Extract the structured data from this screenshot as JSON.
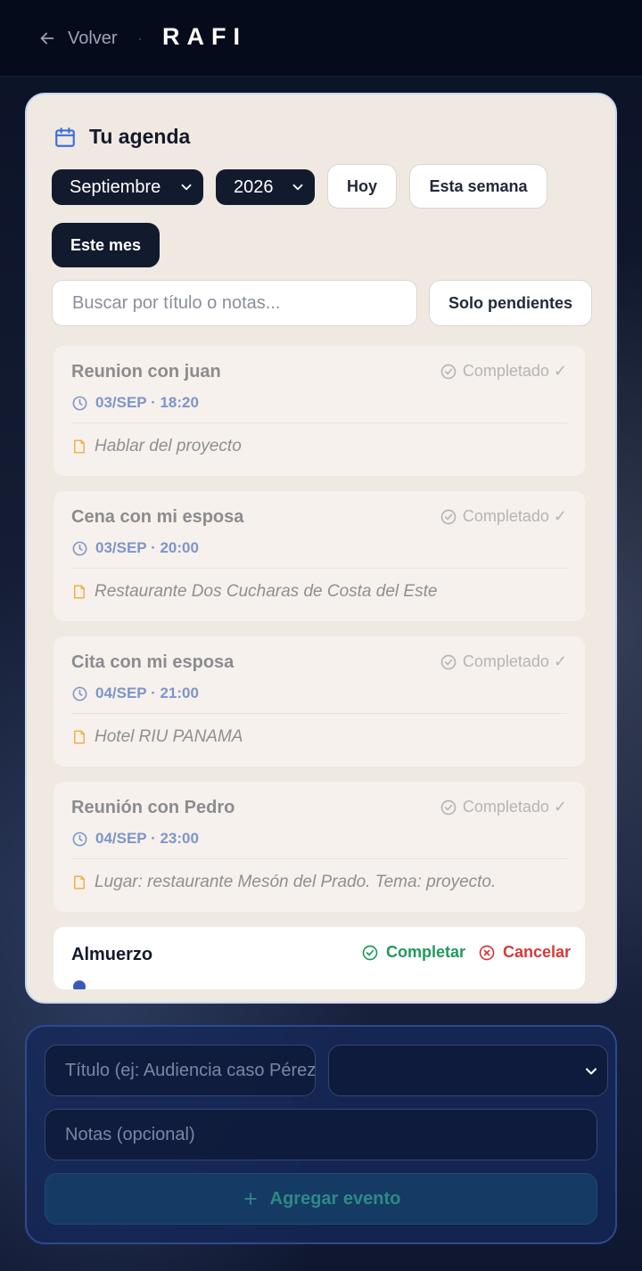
{
  "header": {
    "back_label": "Volver",
    "separator": "·",
    "brand": "RAFI"
  },
  "agenda": {
    "title": "Tu agenda",
    "month_select": "Septiembre",
    "year_select": "2026",
    "filters": {
      "today": "Hoy",
      "week": "Esta semana",
      "month": "Este mes",
      "active_filter": "Este mes"
    },
    "search_placeholder": "Buscar por título o notas...",
    "pending_toggle": "Solo pendientes",
    "events": [
      {
        "title": "Reunion con juan",
        "datetime": "03/SEP · 18:20",
        "note": "Hablar del proyecto",
        "status": "Completado ✓"
      },
      {
        "title": "Cena con mi esposa",
        "datetime": "03/SEP · 20:00",
        "note": "Restaurante Dos Cucharas de Costa del Este",
        "status": "Completado ✓"
      },
      {
        "title": "Cita con mi esposa",
        "datetime": "04/SEP · 21:00",
        "note": "Hotel RIU PANAMA",
        "status": "Completado ✓"
      },
      {
        "title": "Reunión con Pedro",
        "datetime": "04/SEP · 23:00",
        "note": "Lugar: restaurante Mesón del Prado. Tema: proyecto.",
        "status": "Completado ✓"
      }
    ],
    "active_event": {
      "title": "Almuerzo",
      "complete_label": "Completar",
      "cancel_label": "Cancelar"
    }
  },
  "form": {
    "title_placeholder": "Título (ej: Audiencia caso Pérez)",
    "type_select_value": "",
    "notes_placeholder": "Notas (opcional)",
    "add_label": "Agregar evento"
  },
  "colors": {
    "accent_green": "#1f9a5a",
    "accent_red": "#d53a3a",
    "date_blue": "#7d95c9",
    "note_orange": "#f2b04a"
  }
}
